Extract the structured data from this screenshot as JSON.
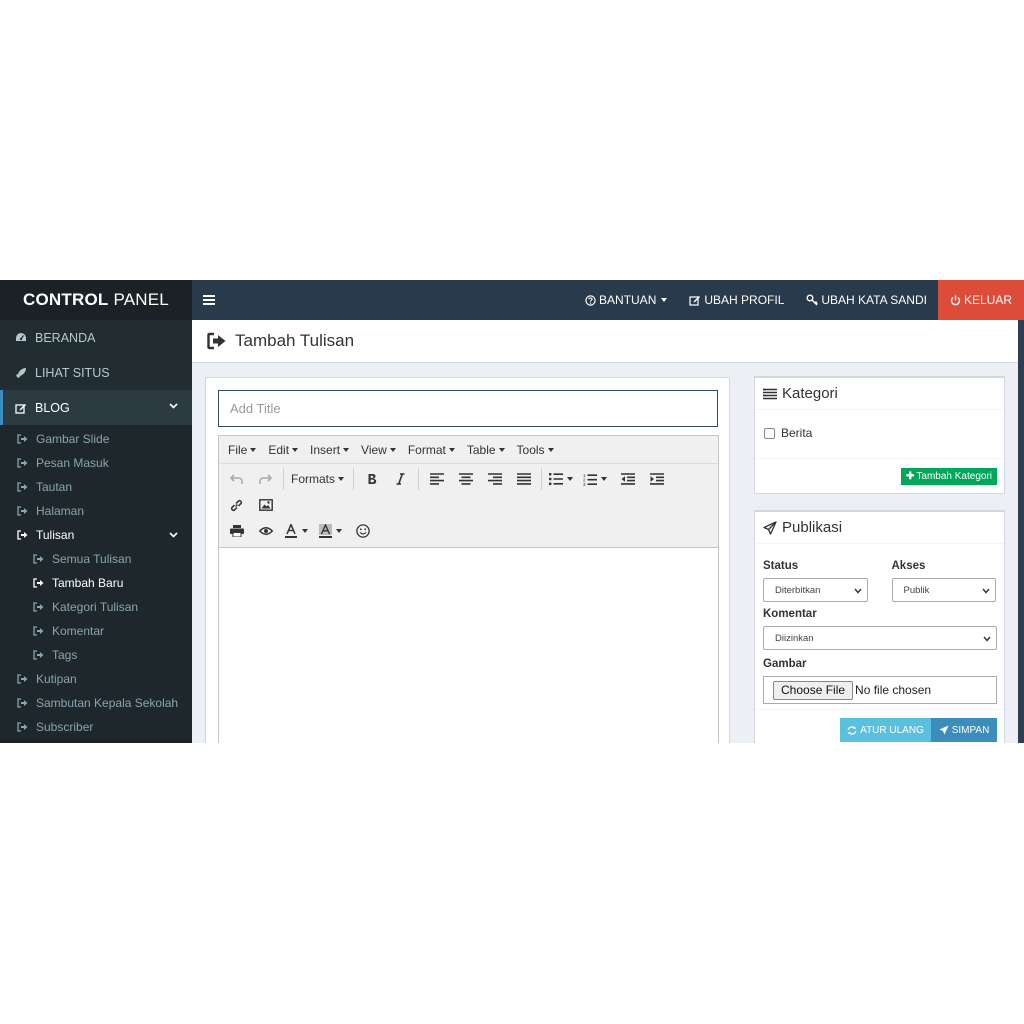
{
  "sidebar": {
    "brand_bold": "CONTROL",
    "brand_light": "PANEL",
    "top_items": [
      {
        "label": "BERANDA",
        "icon": "dashboard-icon"
      },
      {
        "label": "LIHAT SITUS",
        "icon": "rocket-icon"
      }
    ],
    "blog": {
      "label": "BLOG",
      "icon": "edit-icon"
    },
    "blog_items": [
      {
        "label": "Gambar Slide"
      },
      {
        "label": "Pesan Masuk"
      },
      {
        "label": "Tautan"
      },
      {
        "label": "Halaman"
      }
    ],
    "tulisan": {
      "label": "Tulisan"
    },
    "tulisan_items": [
      {
        "label": "Semua Tulisan"
      },
      {
        "label": "Tambah Baru"
      },
      {
        "label": "Kategori Tulisan"
      },
      {
        "label": "Komentar"
      },
      {
        "label": "Tags"
      }
    ],
    "more_items": [
      {
        "label": "Kutipan"
      },
      {
        "label": "Sambutan Kepala Sekolah"
      },
      {
        "label": "Subscriber"
      }
    ]
  },
  "topnav": {
    "help": "BANTUAN",
    "profile": "UBAH PROFIL",
    "password": "UBAH KATA SANDI",
    "logout": "KELUAR"
  },
  "page": {
    "title": "Tambah Tulisan"
  },
  "editor": {
    "title_placeholder": "Add Title",
    "menus": [
      "File",
      "Edit",
      "Insert",
      "View",
      "Format",
      "Table",
      "Tools"
    ],
    "formats_label": "Formats"
  },
  "kategori": {
    "title": "Kategori",
    "items": [
      {
        "label": "Berita",
        "checked": false
      }
    ],
    "add_button": "Tambah Kategori"
  },
  "publikasi": {
    "title": "Publikasi",
    "status_label": "Status",
    "status_value": "Diterbitkan",
    "akses_label": "Akses",
    "akses_value": "Publik",
    "komentar_label": "Komentar",
    "komentar_value": "Diizinkan",
    "gambar_label": "Gambar",
    "file_button": "Choose File",
    "file_status": "No file chosen",
    "reset_button": "ATUR ULANG",
    "save_button": "SIMPAN"
  },
  "colors": {
    "sidebar_bg": "#222d32",
    "topnav_bg": "#283a4c",
    "logout_bg": "#dd4b39",
    "success": "#00a65a",
    "info": "#5bc0de",
    "primary": "#3c8dbc"
  }
}
